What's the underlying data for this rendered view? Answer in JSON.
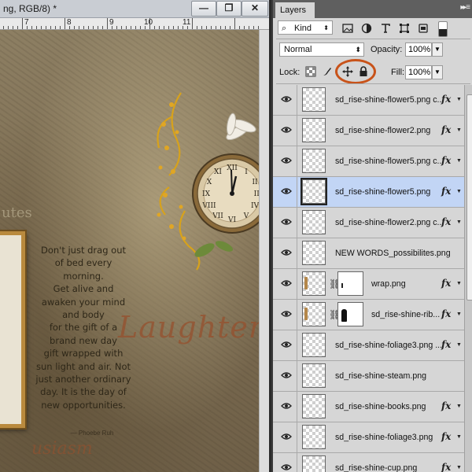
{
  "document": {
    "title": "ng, RGB/8) *",
    "window_buttons": {
      "minimize": "—",
      "maximize": "❐",
      "close": "✕"
    },
    "ruler_labels": [
      "7",
      "8",
      "9",
      "10",
      "11"
    ],
    "canvas": {
      "quote_lines": [
        "Don't just drag out",
        "of bed every",
        "morning.",
        "Get alive and",
        "awaken your mind",
        "and body",
        "for the gift of a",
        "brand new day",
        "gift wrapped with",
        "sun light and air. Not",
        "just another ordinary",
        "day. It is the day of",
        "new opportunities."
      ],
      "quote_credit": "— Phoebe Ruh",
      "decorative_title": "Laughter",
      "faint_word": "utes",
      "bottom_word": "usiasm"
    }
  },
  "layers_panel": {
    "tab_label": "Layers",
    "menu_glyph": "▸▸ ≡",
    "filter": {
      "kind_label": "Kind"
    },
    "blend_mode": "Normal",
    "opacity_label": "Opacity:",
    "opacity_value": "100%",
    "lock_label": "Lock:",
    "fill_label": "Fill:",
    "fill_value": "100%",
    "layers": [
      {
        "name": "sd_rise-shine-flower5.png c...",
        "fx": true,
        "selected": false,
        "mask": false
      },
      {
        "name": "sd_rise-shine-flower2.png",
        "fx": true,
        "selected": false,
        "mask": false
      },
      {
        "name": "sd_rise-shine-flower5.png c...",
        "fx": true,
        "selected": false,
        "mask": false
      },
      {
        "name": "sd_rise-shine-flower5.png",
        "fx": true,
        "selected": true,
        "mask": false
      },
      {
        "name": "sd_rise-shine-flower2.png c...",
        "fx": true,
        "selected": false,
        "mask": false
      },
      {
        "name": "NEW WORDS_possibilites.png",
        "fx": false,
        "selected": false,
        "mask": false
      },
      {
        "name": "wrap.png",
        "fx": true,
        "selected": false,
        "mask": true
      },
      {
        "name": "sd_rise-shine-rib...",
        "fx": true,
        "selected": false,
        "mask": true
      },
      {
        "name": "sd_rise-shine-foliage3.png ...",
        "fx": true,
        "selected": false,
        "mask": false
      },
      {
        "name": "sd_rise-shine-steam.png",
        "fx": false,
        "selected": false,
        "mask": false
      },
      {
        "name": "sd_rise-shine-books.png",
        "fx": true,
        "selected": false,
        "mask": false
      },
      {
        "name": "sd_rise-shine-foliage3.png",
        "fx": true,
        "selected": false,
        "mask": false
      },
      {
        "name": "sd_rise-shine-cup.png",
        "fx": true,
        "selected": false,
        "mask": false
      }
    ],
    "fx_label": "fx",
    "highlight_color": "#c8531a",
    "selected_row_color": "#c2d5f5"
  }
}
